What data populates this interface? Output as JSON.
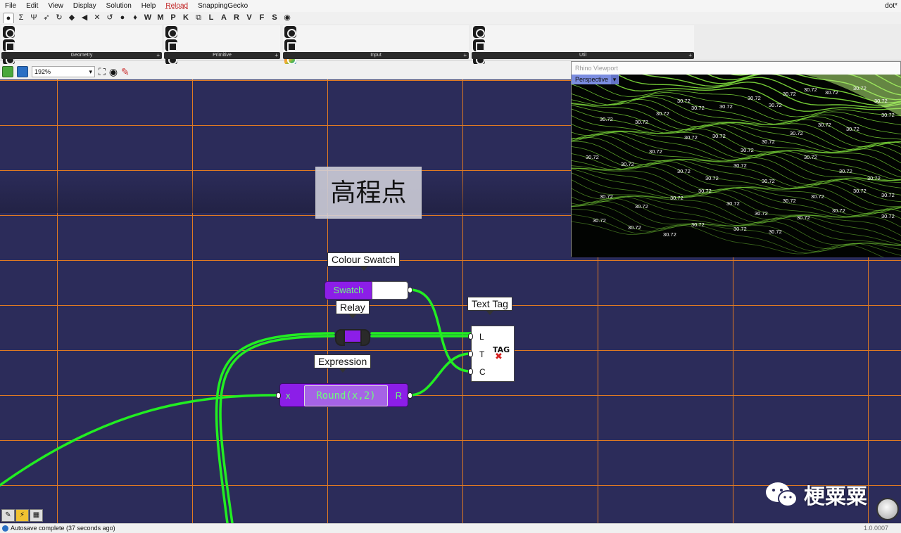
{
  "menubar": {
    "items": [
      "File",
      "Edit",
      "View",
      "Display",
      "Solution",
      "Help",
      "Reload",
      "SnappingGecko"
    ],
    "document_name": "dot*"
  },
  "category_tabs": [
    "●",
    "Σ",
    "Ψ",
    "➶",
    "↻",
    "◆",
    "◀",
    "✕",
    "↺",
    "●",
    "♦",
    "W",
    "M",
    "P",
    "K",
    "⧉",
    "L",
    "A",
    "R",
    "V",
    "F",
    "S",
    "◉"
  ],
  "ribbon_panels": [
    {
      "label": "Geometry",
      "icon_count": 16
    },
    {
      "label": "Primitive",
      "icon_count": 16
    },
    {
      "label": "Input",
      "icon_count": 24
    },
    {
      "label": "Util",
      "icon_count": 20
    }
  ],
  "canvas_toolbar": {
    "zoom": "192%"
  },
  "canvas": {
    "scribble": "高程点",
    "colour_swatch": {
      "tooltip": "Colour Swatch",
      "label": "Swatch",
      "color": "#ffffff"
    },
    "relay": {
      "tooltip": "Relay"
    },
    "text_tag": {
      "tooltip": "Text Tag",
      "inputs": [
        "L",
        "T",
        "C"
      ],
      "icon_text": "TAG"
    },
    "expression": {
      "tooltip": "Expression",
      "input": "x",
      "body": "Round(x,2)",
      "output": "R"
    },
    "wire_color": "#22ee22",
    "grid_color": "#e07a22",
    "background_color": "#2c2c5a"
  },
  "viewport": {
    "title": "Rhino Viewport",
    "tab": "Perspective",
    "contour_label": "30.72",
    "terrain_color": "#7cd93a"
  },
  "watermark": {
    "text": "梗粟粟"
  },
  "statusbar": {
    "message": "Autosave complete (37 seconds ago)",
    "version": "1.0.0007"
  }
}
